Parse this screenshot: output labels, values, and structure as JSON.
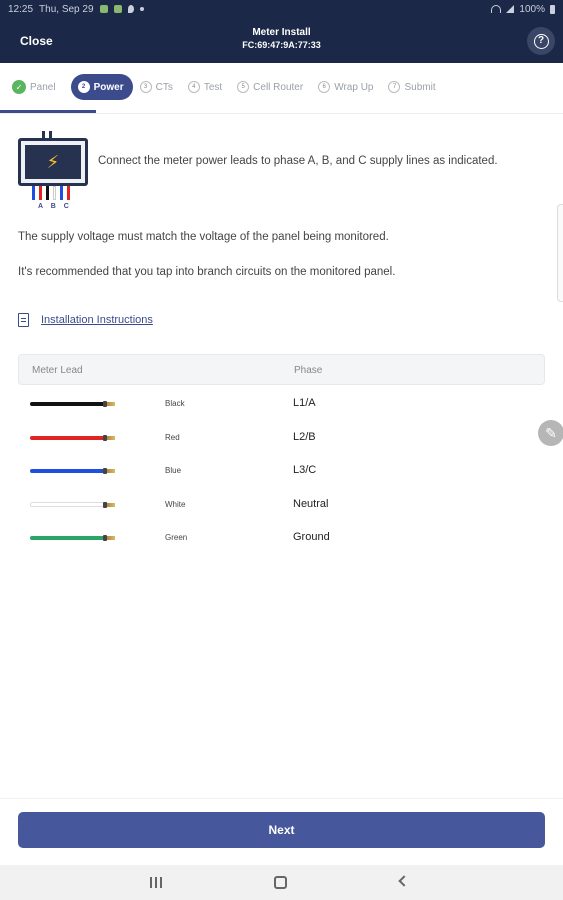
{
  "status_bar": {
    "time": "12:25",
    "date": "Thu, Sep 29",
    "battery": "100%"
  },
  "header": {
    "close_label": "Close",
    "title": "Meter Install",
    "subtitle": "FC:69:47:9A:77:33",
    "help_icon": "?"
  },
  "steps": [
    {
      "num": "✓",
      "label": "Panel",
      "state": "done"
    },
    {
      "num": "2",
      "label": "Power",
      "state": "active"
    },
    {
      "num": "3",
      "label": "CTs",
      "state": "pending"
    },
    {
      "num": "4",
      "label": "Test",
      "state": "pending"
    },
    {
      "num": "5",
      "label": "Cell Router",
      "state": "pending"
    },
    {
      "num": "6",
      "label": "Wrap Up",
      "state": "pending"
    },
    {
      "num": "7",
      "label": "Submit",
      "state": "pending"
    }
  ],
  "illustration": {
    "icon": "lightning-bolt",
    "abc_label": "A B C"
  },
  "content": {
    "intro": "Connect the meter power leads to phase A, B, and C supply lines as indicated.",
    "para1": "The supply voltage must match the voltage of the panel being  monitored.",
    "para2": "It's recommended that you tap into branch circuits on the monitored panel.",
    "link_label": "Installation Instructions"
  },
  "table": {
    "headers": {
      "lead": "Meter Lead",
      "phase": "Phase"
    },
    "rows": [
      {
        "lead": "Black",
        "phase": "L1/A",
        "color": "#111111"
      },
      {
        "lead": "Red",
        "phase": "L2/B",
        "color": "#e02424"
      },
      {
        "lead": "Blue",
        "phase": "L3/C",
        "color": "#1f4fe0"
      },
      {
        "lead": "White",
        "phase": "Neutral",
        "color": "#ffffff"
      },
      {
        "lead": "Green",
        "phase": "Ground",
        "color": "#2aa565"
      }
    ]
  },
  "footer": {
    "next_label": "Next"
  },
  "colors": {
    "header_bg": "#1c2847",
    "accent": "#3b4b8c",
    "button": "#46579b",
    "done": "#5bb55f"
  }
}
